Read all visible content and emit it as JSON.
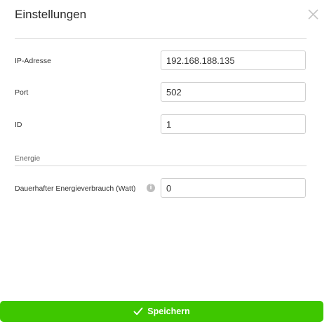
{
  "dialog": {
    "title": "Einstellungen",
    "close_icon": "close-icon"
  },
  "fields": {
    "ip": {
      "label": "IP-Adresse",
      "value": "192.168.188.135"
    },
    "port": {
      "label": "Port",
      "value": "502"
    },
    "id": {
      "label": "ID",
      "value": "1"
    }
  },
  "energy": {
    "section_label": "Energie",
    "consumption": {
      "label": "Dauerhafter Energieverbrauch (Watt)",
      "value": "0",
      "info_icon": "info-icon"
    }
  },
  "footer": {
    "save_label": "Speichern",
    "save_icon": "checkmark-icon",
    "save_color": "#3ec700"
  }
}
